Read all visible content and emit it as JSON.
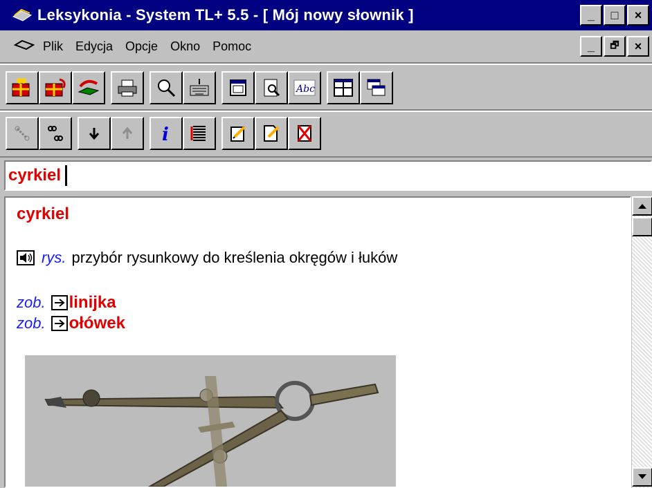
{
  "window": {
    "title": "Leksykonia - System TL+ 5.5 - [ Mój nowy słownik ]",
    "controls": [
      "_",
      "□",
      "×"
    ],
    "mdi_controls": [
      "_",
      "🗗",
      "×"
    ]
  },
  "menu": {
    "items": [
      {
        "label": "Plik"
      },
      {
        "label": "Edycja"
      },
      {
        "label": "Opcje"
      },
      {
        "label": "Okno"
      },
      {
        "label": "Pomoc"
      }
    ]
  },
  "toolbar1": {
    "icons": [
      "new-dictionary-icon",
      "open-dictionary-icon",
      "book-icon",
      "print-icon",
      "search-icon",
      "keyboard-icon",
      "window-icon",
      "preview-icon",
      "spell-check-icon",
      "split-view-icon",
      "cascade-windows-icon"
    ]
  },
  "toolbar2": {
    "icons": [
      "link-disabled-icon",
      "link-icon",
      "arrow-down-icon",
      "arrow-up-disabled-icon",
      "info-icon",
      "list-icon",
      "edit-entry-icon",
      "new-entry-icon",
      "delete-entry-icon"
    ]
  },
  "search": {
    "value": "cyrkiel"
  },
  "entry": {
    "headword": "cyrkiel",
    "label": "rys.",
    "definition": "przybór rysunkowy do kreślenia okręgów i łuków",
    "refs": [
      {
        "prefix": "zob.",
        "word": "linijka"
      },
      {
        "prefix": "zob.",
        "word": "ołówek"
      }
    ]
  },
  "colors": {
    "title_bg": "#000080",
    "headword": "#e00000",
    "label_blue": "#1a1aff"
  }
}
